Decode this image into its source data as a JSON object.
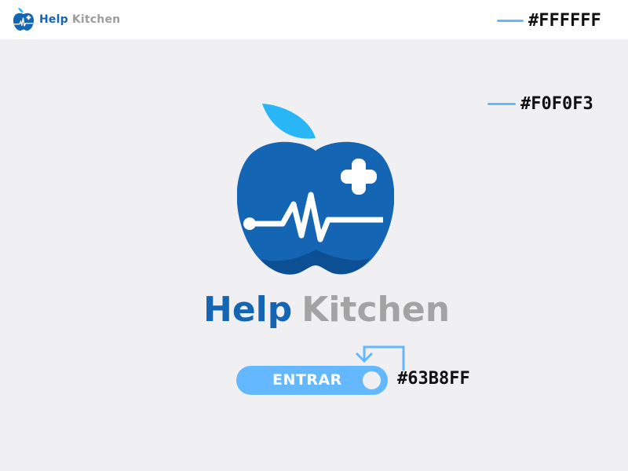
{
  "header": {
    "brand_help": "Help",
    "brand_kitchen": "Kitchen",
    "background_color_label": "#FFFFFF"
  },
  "main": {
    "background_color_label": "#F0F0F3",
    "logo_icon": "apple-heartbeat-logo",
    "title_help": "Help",
    "title_kitchen": "Kitchen",
    "enter_button_label": "ENTRAR",
    "button_color_label": "#63B8FF"
  },
  "colors": {
    "header_bg": "#FFFFFF",
    "page_bg": "#F0F0F3",
    "accent": "#63B8FF",
    "brand_blue": "#1565b5",
    "brand_gray": "#9e9e9e"
  }
}
